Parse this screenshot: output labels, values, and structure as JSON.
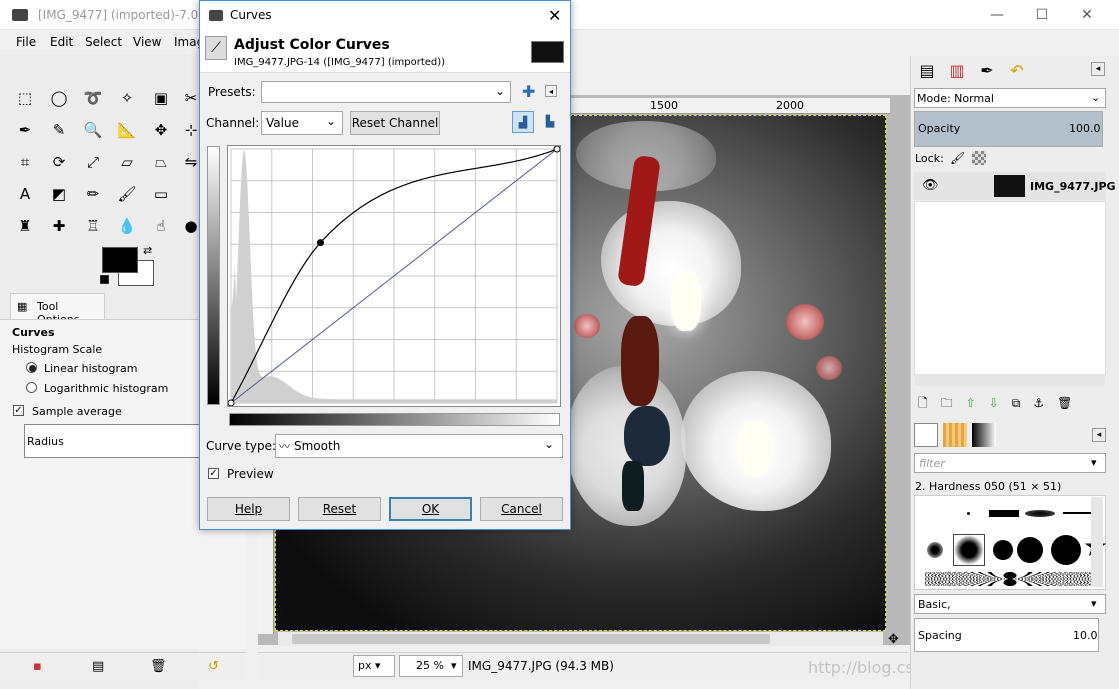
{
  "main": {
    "title": "[IMG_9477] (imported)-7.0 (",
    "menu": [
      "File",
      "Edit",
      "Select",
      "View",
      "Imag"
    ]
  },
  "tool_options": {
    "tab_label": "Tool Options",
    "heading": "Curves",
    "histogram_scale": "Histogram Scale",
    "linear": "Linear histogram",
    "logarithmic": "Logarithmic histogram",
    "sample_average": "Sample average",
    "radius": "Radius"
  },
  "canvas": {
    "ruler_labels": [
      "1500",
      "2000"
    ],
    "unit": "px",
    "zoom": "25 %",
    "status": "IMG_9477.JPG (94.3 MB)",
    "watermark": "http://blog.csdn.net/liyuanbhu"
  },
  "layers": {
    "mode_label": "Mode: Normal",
    "opacity_label": "Opacity",
    "opacity_value": "100.0",
    "lock_label": "Lock:",
    "layer_name": "IMG_9477.JPG"
  },
  "brushes": {
    "filter_placeholder": "filter",
    "current_brush": "2. Hardness 050 (51 × 51)",
    "preset": "Basic,",
    "spacing_label": "Spacing",
    "spacing_value": "10.0"
  },
  "dialog": {
    "title": "Curves",
    "header": "Adjust Color Curves",
    "subheader": "IMG_9477.JPG-14 ([IMG_9477] (imported))",
    "presets_label": "Presets:",
    "presets_value": "",
    "channel_label": "Channel:",
    "channel_value": "Value",
    "reset_channel": "Reset Channel",
    "curve_type_label": "Curve type:",
    "curve_type_value": "Smooth",
    "preview_label": "Preview",
    "buttons": {
      "help": "Help",
      "reset": "Reset",
      "ok": "OK",
      "cancel": "Cancel"
    }
  },
  "curve_data": {
    "control_points": [
      [
        0,
        0
      ],
      [
        70,
        161
      ],
      [
        255,
        255
      ]
    ],
    "range": [
      0,
      255
    ]
  },
  "colors": {
    "accent": "#3c7fb1",
    "foreground": "#000000",
    "background": "#ffffff"
  }
}
